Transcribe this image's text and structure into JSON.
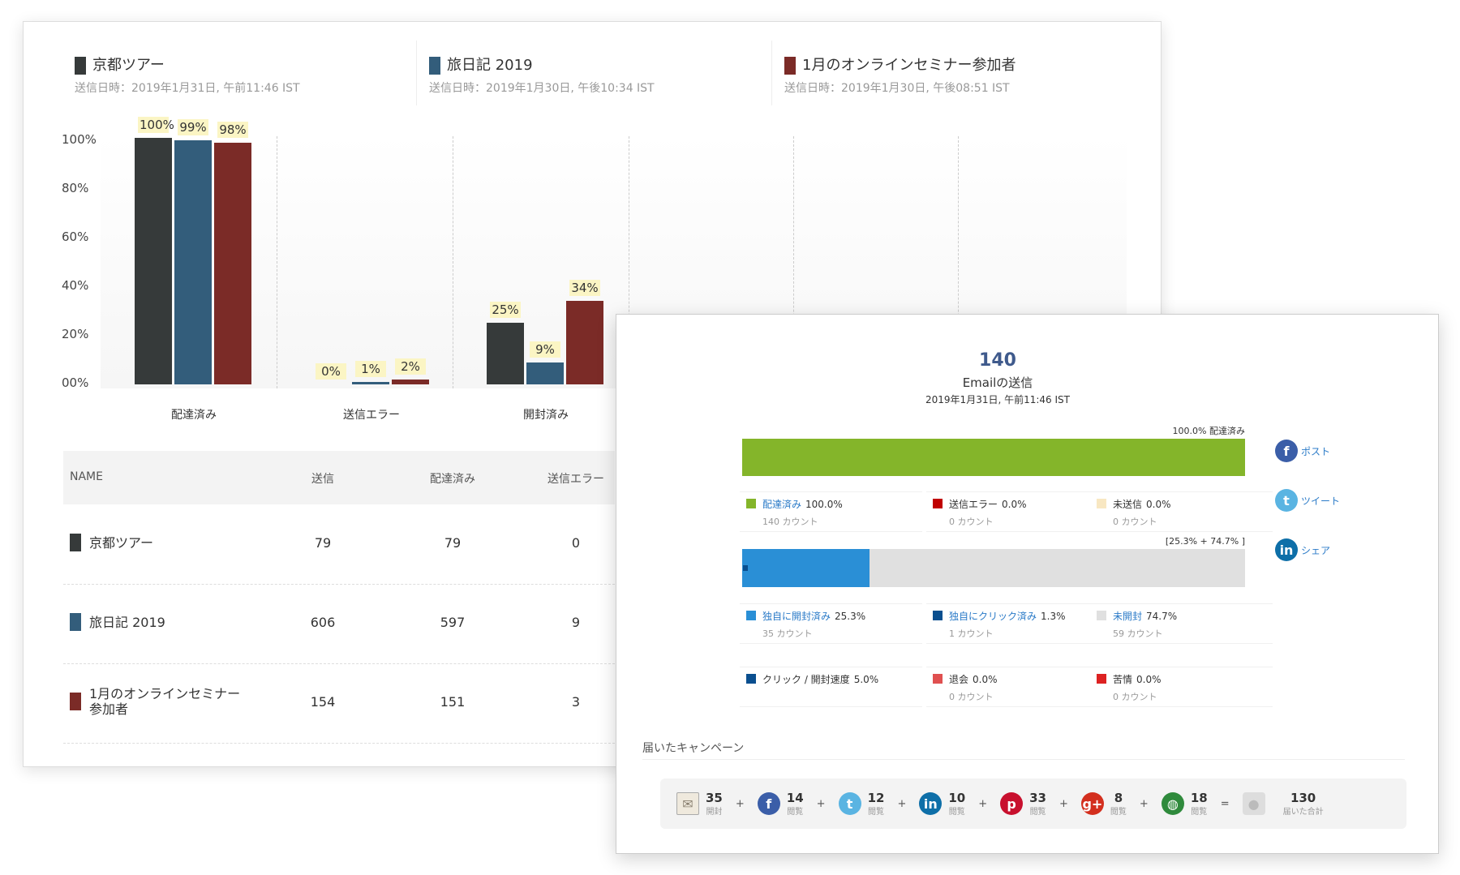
{
  "campaigns": [
    {
      "name": "京都ツアー",
      "date": "送信日時：2019年1月31日, 午前11:46 IST",
      "color": "#363a3a"
    },
    {
      "name": "旅日記 2019",
      "date": "送信日時：2019年1月30日, 午後10:34 IST",
      "color": "#335d7b"
    },
    {
      "name": "1月のオンラインセミナー参加者",
      "date": "送信日時：2019年1月30日, 午後08:51 IST",
      "color": "#7b2b27"
    }
  ],
  "chart_data": {
    "type": "bar",
    "categories": [
      "配達済み",
      "送信エラー",
      "開封済み"
    ],
    "series": [
      {
        "name": "京都ツアー",
        "values": [
          100,
          0,
          25
        ],
        "labels": [
          "100%",
          "0%",
          "25%"
        ]
      },
      {
        "name": "旅日記 2019",
        "values": [
          99,
          1,
          9
        ],
        "labels": [
          "99%",
          "1%",
          "9%"
        ]
      },
      {
        "name": "1月のオンラインセミナー参加者",
        "values": [
          98,
          2,
          34
        ],
        "labels": [
          "98%",
          "2%",
          "34%"
        ]
      }
    ],
    "yticks": [
      "100%",
      "80%",
      "60%",
      "40%",
      "20%",
      "00%"
    ],
    "ylim": [
      0,
      100
    ]
  },
  "table": {
    "headers": [
      "NAME",
      "送信",
      "配達済み",
      "送信エラー"
    ],
    "rows": [
      {
        "name": "京都ツアー",
        "sent": "79",
        "delivered": "79",
        "errors": "0"
      },
      {
        "name": "旅日記 2019",
        "sent": "606",
        "delivered": "597",
        "errors": "9"
      },
      {
        "name": "1月のオンラインセミナー\n参加者",
        "sent": "154",
        "delivered": "151",
        "errors": "3"
      }
    ]
  },
  "detail": {
    "count": "140",
    "title": "Emailの送信",
    "date": "2019年1月31日, 午前11:46 IST",
    "bar1_label": "100.0% 配達済み",
    "bar1_fill": 100,
    "bar2_label": "[25.3% + 74.7% ]",
    "bar2_fill": 25.3,
    "legend1": [
      {
        "label": "配達済み",
        "value": "100.0%",
        "count": "140 カウント",
        "color": "#84b52a",
        "link": true
      },
      {
        "label": "送信エラー",
        "value": "0.0%",
        "count": "0 カウント",
        "color": "#c00000",
        "link": false
      },
      {
        "label": "未送信",
        "value": "0.0%",
        "count": "0 カウント",
        "color": "#f8e7c2",
        "link": false
      }
    ],
    "legend2": [
      {
        "label": "独自に開封済み",
        "value": "25.3%",
        "count": "35 カウント",
        "color": "#2a8fd6",
        "link": true
      },
      {
        "label": "独自にクリック済み",
        "value": "1.3%",
        "count": "1 カウント",
        "color": "#0a4f8f",
        "link": true
      },
      {
        "label": "未開封",
        "value": "74.7%",
        "count": "59 カウント",
        "color": "#e0e0e0",
        "link": true
      }
    ],
    "legend3": [
      {
        "label": "クリック / 開封速度",
        "value": "5.0%",
        "count": "",
        "color": "#0a4f8f"
      },
      {
        "label": "退会",
        "value": "0.0%",
        "count": "0 カウント",
        "color": "#e05050"
      },
      {
        "label": "苦情",
        "value": "0.0%",
        "count": "0 カウント",
        "color": "#d22"
      }
    ],
    "social": [
      {
        "label": "ポスト",
        "icon": "facebook-icon",
        "color": "#3b5ea8",
        "glyph": "f"
      },
      {
        "label": "ツイート",
        "icon": "twitter-icon",
        "color": "#5ab4e2",
        "glyph": "t"
      },
      {
        "label": "シェア",
        "icon": "linkedin-icon",
        "color": "#0e6fa8",
        "glyph": "in"
      }
    ],
    "reach_title": "届いたキャンペーン",
    "reach": [
      {
        "icon": "envelope-icon",
        "n": "35",
        "l": "開封",
        "color": "#d9d3c7",
        "glyph": "✉"
      },
      {
        "icon": "facebook-icon",
        "n": "14",
        "l": "閲覧",
        "color": "#3b5ea8",
        "glyph": "f"
      },
      {
        "icon": "twitter-icon",
        "n": "12",
        "l": "閲覧",
        "color": "#5ab4e2",
        "glyph": "t"
      },
      {
        "icon": "linkedin-icon",
        "n": "10",
        "l": "閲覧",
        "color": "#0e6fa8",
        "glyph": "in"
      },
      {
        "icon": "pinterest-icon",
        "n": "33",
        "l": "閲覧",
        "color": "#c8102e",
        "glyph": "p"
      },
      {
        "icon": "googleplus-icon",
        "n": "8",
        "l": "閲覧",
        "color": "#d32f1e",
        "glyph": "g+"
      },
      {
        "icon": "globe-icon",
        "n": "18",
        "l": "閲覧",
        "color": "#2f8a3c",
        "glyph": "◍"
      }
    ],
    "total": {
      "n": "130",
      "l": "届いた合計"
    }
  }
}
